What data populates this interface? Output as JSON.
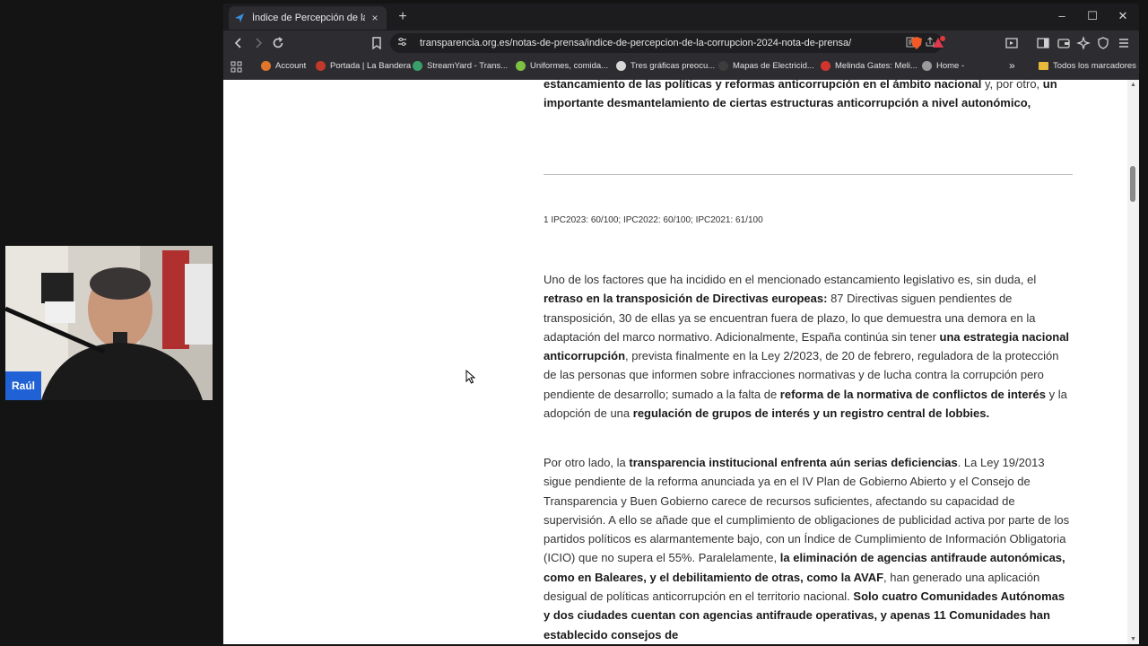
{
  "browser": {
    "tab": {
      "title": "Índice de Percepción de la Corru",
      "close": "×"
    },
    "new_tab": "+",
    "window_controls": {
      "minimize": "–",
      "maximize": "☐",
      "close": "✕"
    },
    "url": "transparencia.org.es/notas-de-prensa/indice-de-percepcion-de-la-corrupcion-2024-nota-de-prensa/",
    "shields_count": "",
    "bookmarks": [
      {
        "label": "Account",
        "color": "#e0762b"
      },
      {
        "label": "Portada | La Bandera",
        "color": "#c0392b"
      },
      {
        "label": "StreamYard - Trans...",
        "color": "#3aa06b"
      },
      {
        "label": "Uniformes, comida...",
        "color": "#7cc142"
      },
      {
        "label": "Tres gráficas preocu...",
        "color": "#d8d8d8"
      },
      {
        "label": "Mapas de Electricid...",
        "color": "#3d3d3d"
      },
      {
        "label": "Melinda Gates: Meli...",
        "color": "#d0352e"
      },
      {
        "label": "Home -",
        "color": "#9a9a9a"
      }
    ],
    "bookmarks_more": "»",
    "all_bookmarks": "Todos los marcadores"
  },
  "article": {
    "top": {
      "b1": "estancamiento de las políticas y reformas anticorrupción en el ámbito nacional",
      "t1": " y, por otro, ",
      "b2": "un importante desmantelamiento de ciertas estructuras anticorrupción a nivel autonómico,"
    },
    "footnote": "1 IPC2023: 60/100; IPC2022: 60/100; IPC2021: 61/100",
    "p1": {
      "t1": "Uno de los factores que ha incidido en el mencionado estancamiento legislativo es, sin duda, el ",
      "b1": "retraso en la transposición de Directivas europeas:",
      "t2": " 87 Directivas siguen pendientes de transposición, 30 de ellas ya se encuentran fuera de plazo, lo que demuestra una demora en la adaptación del marco normativo. Adicionalmente, España continúa sin tener ",
      "b2": "una estrategia nacional anticorrupción",
      "t3": ", prevista finalmente en la Ley 2/2023, de 20 de febrero, reguladora de la protección de las personas que informen sobre infracciones normativas y de lucha contra la corrupción pero pendiente de desarrollo; sumado a la falta de ",
      "b3": "reforma de la normativa de conflictos de interés",
      "t4": " y la adopción de una ",
      "b4": "regulación de grupos de interés y un registro central de lobbies."
    },
    "p2": {
      "t1": "Por otro lado, la ",
      "b1": "transparencia institucional enfrenta aún serias deficiencias",
      "t2": ". La Ley 19/2013 sigue pendiente de la reforma anunciada ya en el IV Plan de Gobierno Abierto y el Consejo de Transparencia y Buen Gobierno carece de recursos suficientes, afectando su capacidad de supervisión. A ello se añade que el cumplimiento de obligaciones de publicidad activa por parte de los partidos políticos es alarmantemente bajo, con un Índice de Cumplimiento de Información Obligatoria (ICIO) que no supera el 55%. Paralelamente, ",
      "b2": "la eliminación de agencias antifraude autonómicas, como en Baleares, y el debilitamiento de otras, como la AVAF",
      "t3": ", han generado una aplicación desigual de políticas anticorrupción en el territorio nacional. ",
      "b3": "Solo cuatro Comunidades Autónomas y dos ciudades cuentan con agencias antifraude operativas, y apenas 11 Comunidades han establecido consejos de"
    }
  },
  "webcam": {
    "name": "Raúl"
  }
}
